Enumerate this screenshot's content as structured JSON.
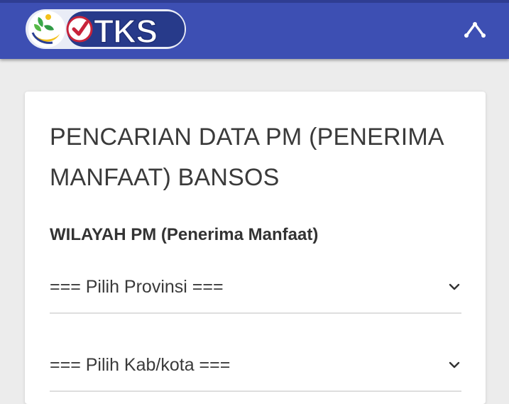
{
  "header": {
    "logo_text": "DTKS",
    "menu_icon": "chevron-up-icon",
    "bar_color": "#3d4fb3"
  },
  "main": {
    "title": "PENCARIAN DATA PM (PENERIMA MANFAAT) BANSOS",
    "section_label": "WILAYAH PM (Penerima Manfaat)",
    "province_select": {
      "value": "=== Pilih Provinsi ===",
      "icon": "chevron-down-icon"
    },
    "city_select": {
      "value": "=== Pilih Kab/kota ===",
      "icon": "chevron-down-icon"
    }
  }
}
